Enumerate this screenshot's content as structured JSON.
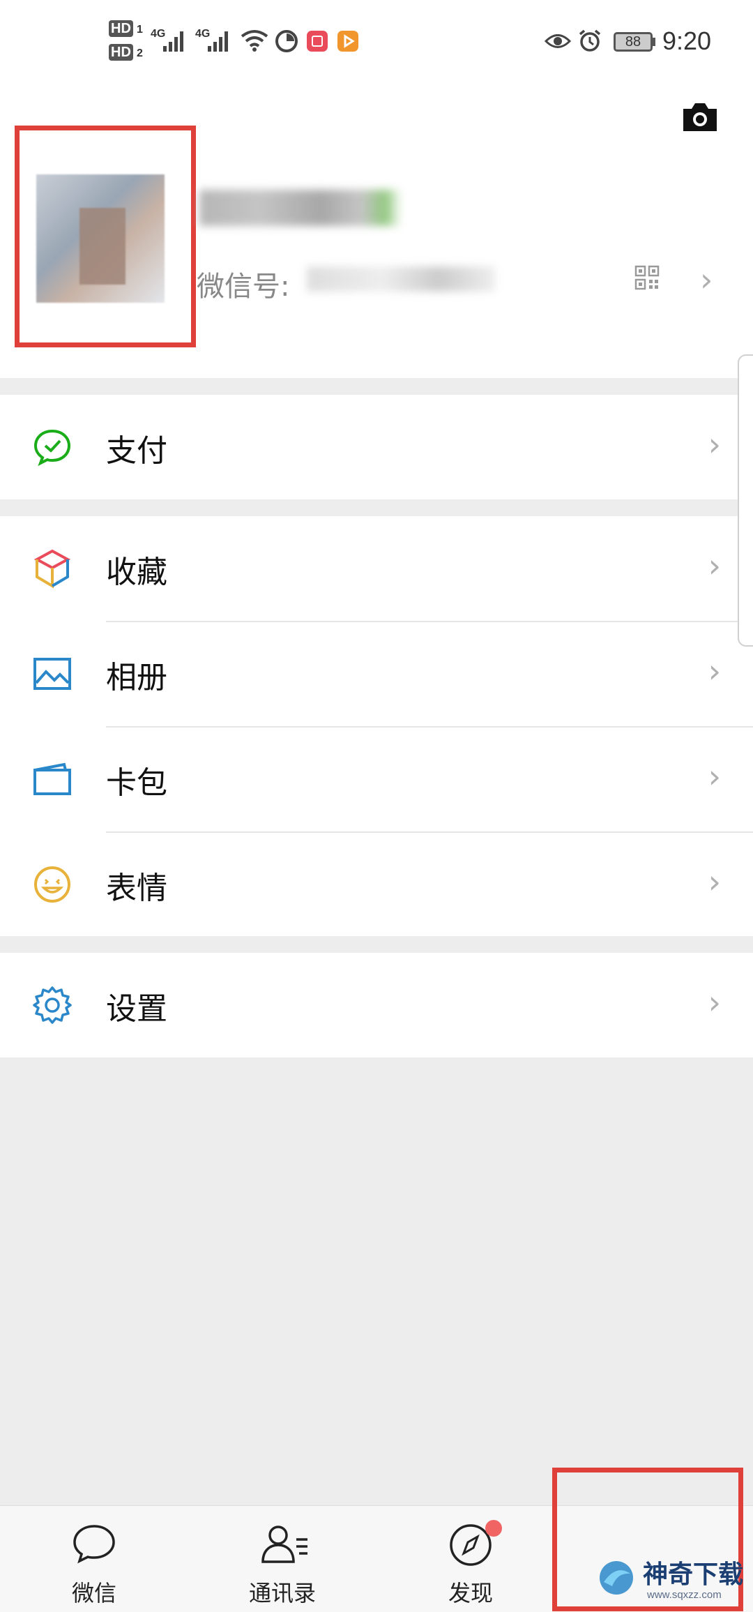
{
  "status_bar": {
    "hd1": "HD",
    "sim1": "1",
    "hd2": "HD",
    "sim2": "2",
    "net1": "4G",
    "net2": "4G",
    "battery": "88",
    "time": "9:20"
  },
  "profile": {
    "wechat_id_label": "微信号:"
  },
  "menu": {
    "pay": "支付",
    "favorites": "收藏",
    "album": "相册",
    "cards": "卡包",
    "stickers": "表情",
    "settings": "设置"
  },
  "tabbar": {
    "chats": "微信",
    "contacts": "通讯录",
    "discover": "发现"
  },
  "watermark": {
    "brand": "神奇下载",
    "url": "www.sqxzz.com"
  },
  "colors": {
    "highlight_red": "#e0403a",
    "badge_red": "#f06464",
    "pay_green": "#1aad19",
    "icon_blue": "#2a87c9",
    "sticker_yellow": "#e8b23a"
  }
}
